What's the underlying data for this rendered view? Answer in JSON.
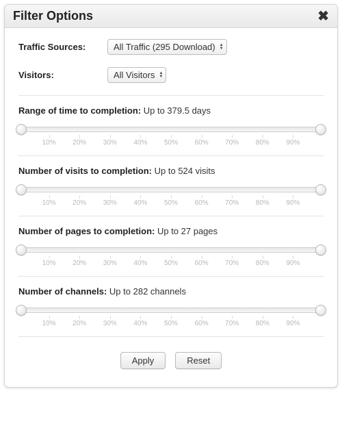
{
  "title": "Filter Options",
  "selects": {
    "traffic_sources": {
      "label": "Traffic Sources:",
      "value": "All Traffic (295 Download)"
    },
    "visitors": {
      "label": "Visitors:",
      "value": "All Visitors"
    }
  },
  "ticks": [
    "10%",
    "20%",
    "30%",
    "40%",
    "50%",
    "60%",
    "70%",
    "80%",
    "90%"
  ],
  "sliders": {
    "time": {
      "label": "Range of time to completion:",
      "value_text": "Up to 379.5 days",
      "low_pct": 1,
      "high_pct": 99
    },
    "visits": {
      "label": "Number of visits to completion:",
      "value_text": "Up to 524 visits",
      "low_pct": 1,
      "high_pct": 99
    },
    "pages": {
      "label": "Number of pages to completion:",
      "value_text": "Up to 27 pages",
      "low_pct": 1,
      "high_pct": 99
    },
    "channels": {
      "label": "Number of channels:",
      "value_text": "Up to 282 channels",
      "low_pct": 1,
      "high_pct": 99
    }
  },
  "buttons": {
    "apply": "Apply",
    "reset": "Reset"
  }
}
